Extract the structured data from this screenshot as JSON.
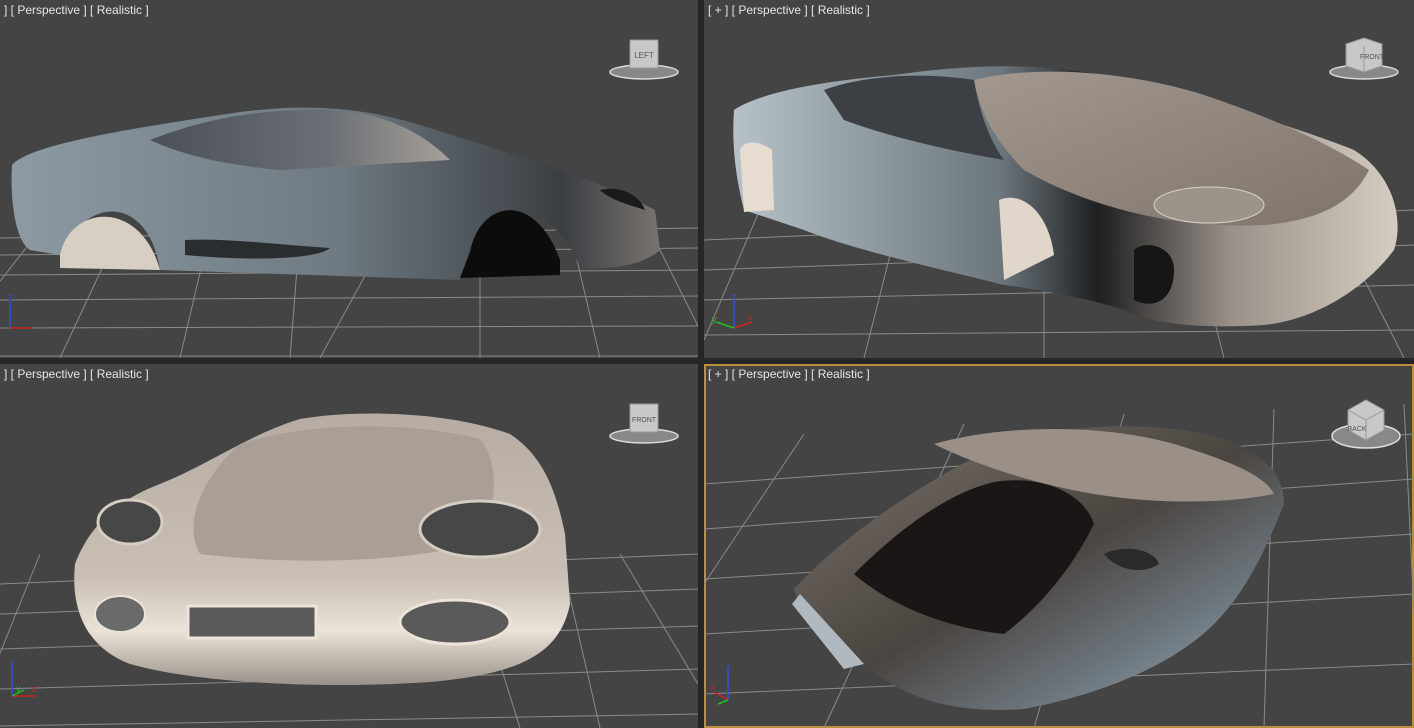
{
  "viewports": [
    {
      "id": "top-left",
      "label": "] [ Perspective ] [ Realistic ]",
      "cube_text": "LEFT",
      "active": false
    },
    {
      "id": "top-right",
      "label": "[ + ] [ Perspective ] [ Realistic ]",
      "cube_text": "FRONT",
      "active": false
    },
    {
      "id": "bottom-left",
      "label": "] [ Perspective ] [ Realistic ]",
      "cube_text": "FRONT",
      "active": false
    },
    {
      "id": "bottom-right",
      "label": "[ + ] [ Perspective ] [ Realistic ]",
      "cube_text": "BACK",
      "active": true
    }
  ],
  "axis_labels": {
    "x": "x",
    "y": "y",
    "z": "z"
  },
  "colors": {
    "viewport_bg": "#444444",
    "grid": "#8a8a8a",
    "active_border": "#b8913a",
    "label_text": "#e6e6e6",
    "axis_x": "#d02020",
    "axis_y": "#20c020",
    "axis_z": "#3050e0"
  }
}
